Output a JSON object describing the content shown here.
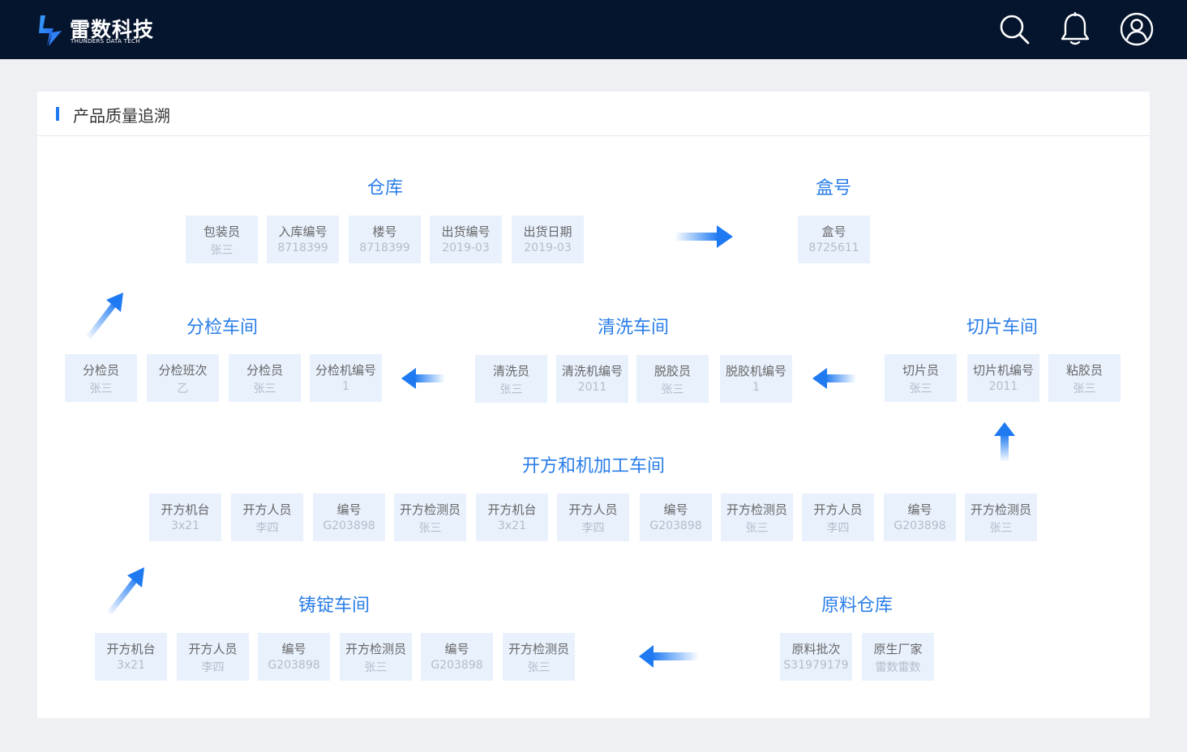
{
  "brand": {
    "name_cn": "雷数科技",
    "name_en": "THUNDERS DATA TECH"
  },
  "header_icons": [
    "search-icon",
    "bell-icon",
    "user-icon"
  ],
  "page_title": "产品质量追溯",
  "colors": {
    "accent": "#1f7af2",
    "topbar": "#06152e",
    "box_bg": "#e9f1fd"
  },
  "sections": {
    "warehouse": {
      "title": "仓库",
      "items": [
        {
          "label": "包装员",
          "value": "张三"
        },
        {
          "label": "入库编号",
          "value": "8718399"
        },
        {
          "label": "楼号",
          "value": "8718399"
        },
        {
          "label": "出货编号",
          "value": "2019-03"
        },
        {
          "label": "出货日期",
          "value": "2019-03"
        }
      ]
    },
    "box": {
      "title": "盒号",
      "items": [
        {
          "label": "盒号",
          "value": "8725611"
        }
      ]
    },
    "sorting": {
      "title": "分检车间",
      "items": [
        {
          "label": "分检员",
          "value": "张三"
        },
        {
          "label": "分检班次",
          "value": "乙"
        },
        {
          "label": "分检员",
          "value": "张三"
        },
        {
          "label": "分检机编号",
          "value": "1"
        }
      ]
    },
    "cleaning": {
      "title": "清洗车间",
      "items": [
        {
          "label": "清洗员",
          "value": "张三"
        },
        {
          "label": "清洗机编号",
          "value": "2011"
        },
        {
          "label": "脱胶员",
          "value": "张三"
        },
        {
          "label": "脱胶机编号",
          "value": "1"
        }
      ]
    },
    "slicing": {
      "title": "切片车间",
      "items": [
        {
          "label": "切片员",
          "value": "张三"
        },
        {
          "label": "切片机编号",
          "value": "2011"
        },
        {
          "label": "粘胶员",
          "value": "张三"
        }
      ]
    },
    "machining": {
      "title": "开方和机加工车间",
      "items": [
        {
          "label": "开方机台",
          "value": "3x21"
        },
        {
          "label": "开方人员",
          "value": "李四"
        },
        {
          "label": "编号",
          "value": "G203898"
        },
        {
          "label": "开方检测员",
          "value": "张三"
        },
        {
          "label": "开方机台",
          "value": "3x21"
        },
        {
          "label": "开方人员",
          "value": "李四"
        },
        {
          "label": "编号",
          "value": "G203898"
        },
        {
          "label": "开方检测员",
          "value": "张三"
        },
        {
          "label": "开方人员",
          "value": "李四"
        },
        {
          "label": "编号",
          "value": "G203898"
        },
        {
          "label": "开方检测员",
          "value": "张三"
        }
      ]
    },
    "casting": {
      "title": "铸锭车间",
      "items": [
        {
          "label": "开方机台",
          "value": "3x21"
        },
        {
          "label": "开方人员",
          "value": "李四"
        },
        {
          "label": "编号",
          "value": "G203898"
        },
        {
          "label": "开方检测员",
          "value": "张三"
        },
        {
          "label": "编号",
          "value": "G203898"
        },
        {
          "label": "开方检测员",
          "value": "张三"
        }
      ]
    },
    "raw": {
      "title": "原料仓库",
      "items": [
        {
          "label": "原料批次",
          "value": "S31979179"
        },
        {
          "label": "原生厂家",
          "value": "雷数雷数"
        }
      ]
    }
  }
}
